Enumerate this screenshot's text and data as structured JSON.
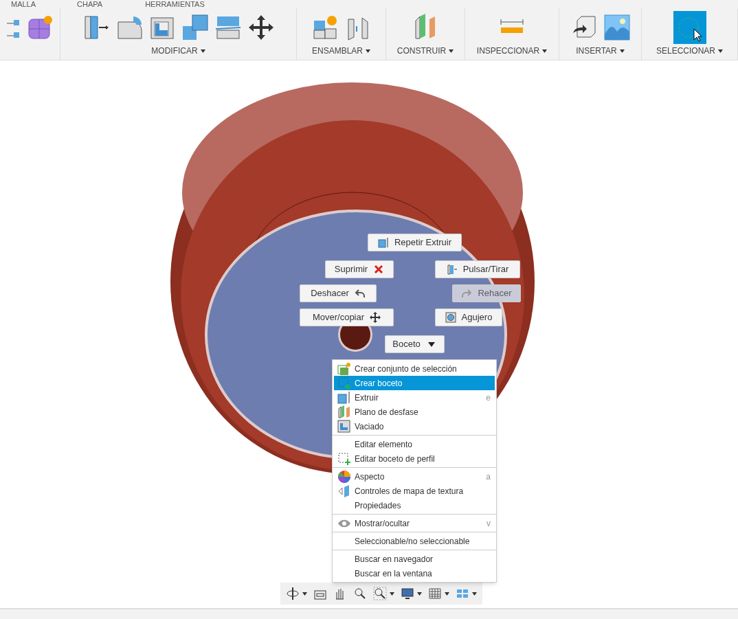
{
  "tabs": [
    {
      "label": "MALLA"
    },
    {
      "label": "CHAPA"
    },
    {
      "label": "HERRAMIENTAS"
    }
  ],
  "toolbar_groups": [
    {
      "label": "MODIFICAR"
    },
    {
      "label": "ENSAMBLAR"
    },
    {
      "label": "CONSTRUIR"
    },
    {
      "label": "INSPECCIONAR"
    },
    {
      "label": "INSERTAR"
    },
    {
      "label": "SELECCIONAR"
    }
  ],
  "marking_menu": [
    {
      "label": "Repetir Extruir",
      "disabled": false
    },
    {
      "label": "Suprimir",
      "disabled": false
    },
    {
      "label": "Pulsar/Tirar",
      "disabled": false
    },
    {
      "label": "Deshacer",
      "disabled": false
    },
    {
      "label": "Rehacer",
      "disabled": true
    },
    {
      "label": "Mover/copiar",
      "disabled": false
    },
    {
      "label": "Agujero",
      "disabled": false
    },
    {
      "label": "Boceto",
      "disabled": false
    }
  ],
  "context_menu": [
    [
      {
        "label": "Crear conjunto de selección",
        "selected": false
      },
      {
        "label": "Crear boceto",
        "selected": true
      },
      {
        "label": "Extruir",
        "shortcut": "e",
        "selected": false
      },
      {
        "label": "Plano de desfase",
        "selected": false
      },
      {
        "label": "Vaciado",
        "selected": false
      }
    ],
    [
      {
        "label": "Editar elemento",
        "selected": false
      },
      {
        "label": "Editar boceto de perfil",
        "selected": false
      }
    ],
    [
      {
        "label": "Aspecto",
        "shortcut": "a",
        "selected": false
      },
      {
        "label": "Controles de mapa de textura",
        "selected": false
      },
      {
        "label": "Propiedades",
        "selected": false
      }
    ],
    [
      {
        "label": "Mostrar/ocultar",
        "shortcut": "v",
        "selected": false
      }
    ],
    [
      {
        "label": "Seleccionable/no seleccionable",
        "selected": false
      }
    ],
    [
      {
        "label": "Buscar en navegador",
        "selected": false
      },
      {
        "label": "Buscar en la ventana",
        "selected": false
      }
    ]
  ]
}
